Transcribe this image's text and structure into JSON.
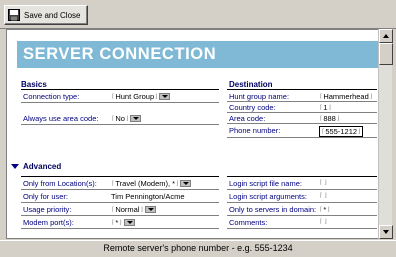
{
  "toolbar": {
    "save_close_label": "Save and Close"
  },
  "header": {
    "title": "SERVER CONNECTION"
  },
  "basics": {
    "title": "Basics",
    "fields": [
      {
        "label": "Connection type:",
        "value": "Hunt Group",
        "dropdown": true
      },
      {
        "label": "Always use area code:",
        "value": "No",
        "dropdown": true
      }
    ]
  },
  "destination": {
    "title": "Destination",
    "fields": [
      {
        "label": "Hunt group name:",
        "value": "Hammerhead"
      },
      {
        "label": "Country code:",
        "value": "1"
      },
      {
        "label": "Area code:",
        "value": "888"
      },
      {
        "label": "Phone number:",
        "value": "555-1212"
      }
    ]
  },
  "advanced": {
    "title": "Advanced",
    "left": [
      {
        "label": "Only from Location(s):",
        "value": "Travel (Modem), *",
        "dropdown": true
      },
      {
        "label": "Only for user:",
        "value": "Tim Pennington/Acme",
        "dropdown": false
      },
      {
        "label": "Usage priority:",
        "value": "Normal",
        "dropdown": true
      },
      {
        "label": "Modem port(s):",
        "value": "*",
        "dropdown": true
      }
    ],
    "right": [
      {
        "label": "Login script file name:",
        "value": ""
      },
      {
        "label": "Login script arguments:",
        "value": ""
      },
      {
        "label": "Only to servers in domain:",
        "value": "*"
      },
      {
        "label": "Comments:",
        "value": ""
      }
    ]
  },
  "status": {
    "text": "Remote server's phone number - e.g. 555-1234"
  }
}
